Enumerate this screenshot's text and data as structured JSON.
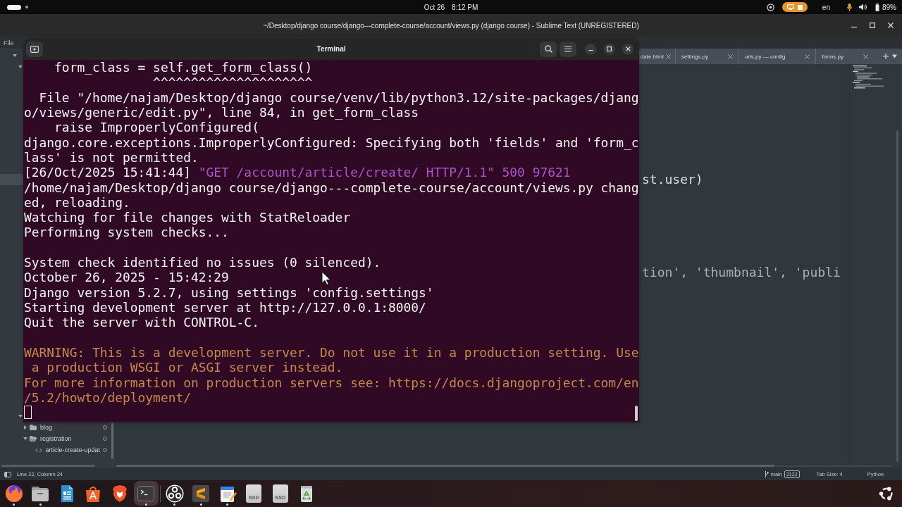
{
  "top_bar": {
    "workspaces": [
      {
        "selected": true
      },
      {
        "selected": false
      }
    ],
    "date": "Oct 26",
    "time": "8:12 PM",
    "keyboard_layout": "en",
    "battery": "89%"
  },
  "editor_window": {
    "title": "~/Desktop/django course/django---complete-course/account/views.py (django course) - Sublime Text (UNREGISTERED)",
    "menu": [
      "File"
    ],
    "sidebar": {
      "items": [
        {
          "kind": "folder",
          "expanded": true,
          "children": [
            {
              "kind": "folder",
              "expanded": true
            },
            {
              "kind": "file",
              "selected": true
            },
            {
              "kind": "folder",
              "expanded": true,
              "children": [
                {
                  "kind": "folder",
                  "label": "blog",
                  "expanded": false
                },
                {
                  "kind": "folder",
                  "label": "registration",
                  "expanded": true,
                  "children": [
                    {
                      "kind": "file",
                      "label": "article-create-updat",
                      "selected": false
                    }
                  ]
                }
              ]
            }
          ]
        }
      ]
    },
    "tabs": [
      {
        "label": "date.html",
        "selected": false
      },
      {
        "label": "settings.py",
        "selected": false
      },
      {
        "label": "urls.py — config",
        "selected": false
      },
      {
        "label": "forms.py",
        "selected": false
      }
    ],
    "code_lines": [
      {
        "kind": "plain",
        "text": "st.user)"
      },
      {
        "kind": "dim",
        "text": "tion', 'thumbnail', 'publi"
      }
    ],
    "status_bar": {
      "position": "Line 22, Column 24",
      "branch": "main",
      "commits": "2122",
      "tab_size": "Tab Size: 4",
      "syntax": "Python"
    }
  },
  "terminal": {
    "title": "Terminal",
    "blocks": [
      [
        {
          "kind": "plain",
          "text": "    form_class = self.get_form_class()"
        },
        {
          "kind": "plain",
          "text": "                 ^^^^^^^^^^^^^^^^^^^^^"
        },
        {
          "kind": "plain",
          "text": "  File \"/home/najam/Desktop/django course/venv/lib/python3.12/site-packages/djang"
        },
        {
          "kind": "plain",
          "text": "o/views/generic/edit.py\", line 84, in get_form_class"
        },
        {
          "kind": "plain",
          "text": "    raise ImproperlyConfigured("
        },
        {
          "kind": "plain",
          "text": "django.core.exceptions.ImproperlyConfigured: Specifying both 'fields' and 'form_c"
        },
        {
          "kind": "plain",
          "text": "lass' is not permitted."
        },
        {
          "kind": "request",
          "timestamp": "[26/Oct/2025 15:41:44]",
          "text": "\"GET /account/article/create/ HTTP/1.1\" 500 97621"
        },
        {
          "kind": "plain",
          "text": "/home/najam/Desktop/django course/django---complete-course/account/views.py chang"
        },
        {
          "kind": "plain",
          "text": "ed, reloading."
        },
        {
          "kind": "plain",
          "text": "Watching for file changes with StatReloader"
        },
        {
          "kind": "plain",
          "text": "Performing system checks..."
        }
      ],
      [
        {
          "kind": "plain",
          "text": "System check identified no issues (0 silenced)."
        },
        {
          "kind": "plain",
          "text": "October 26, 2025 - 15:42:29"
        },
        {
          "kind": "plain",
          "text": "Django version 5.2.7, using settings 'config.settings'"
        },
        {
          "kind": "plain",
          "text": "Starting development server at http://127.0.0.1:8000/"
        },
        {
          "kind": "plain",
          "text": "Quit the server with CONTROL-C."
        }
      ],
      [
        {
          "kind": "warning",
          "text": "WARNING: This is a development server. Do not use it in a production setting. Use"
        },
        {
          "kind": "warning",
          "text": " a production WSGI or ASGI server instead."
        },
        {
          "kind": "warning",
          "text": "For more information on production servers see: https://docs.djangoproject.com/en"
        },
        {
          "kind": "warning",
          "text": "/5.2/howto/deployment/"
        }
      ]
    ],
    "cursor": true
  },
  "dock": {
    "items": [
      {
        "kind": "globe",
        "running": true,
        "focused": false
      },
      {
        "kind": "folder",
        "running": true,
        "focused": false
      },
      {
        "kind": "document",
        "running": false,
        "focused": false
      },
      {
        "kind": "bag",
        "running": false,
        "focused": false
      },
      {
        "kind": "shield",
        "running": false,
        "focused": false
      },
      {
        "kind": "terminal",
        "running": true,
        "focused": true
      },
      {
        "kind": "separator"
      },
      {
        "kind": "rings",
        "running": true,
        "focused": false
      },
      {
        "kind": "stripes",
        "running": true,
        "focused": false
      },
      {
        "kind": "notepad",
        "running": true,
        "focused": false
      },
      {
        "kind": "drive",
        "label": "SSD"
      },
      {
        "kind": "drive",
        "label": "SSD"
      },
      {
        "kind": "trash"
      }
    ]
  }
}
